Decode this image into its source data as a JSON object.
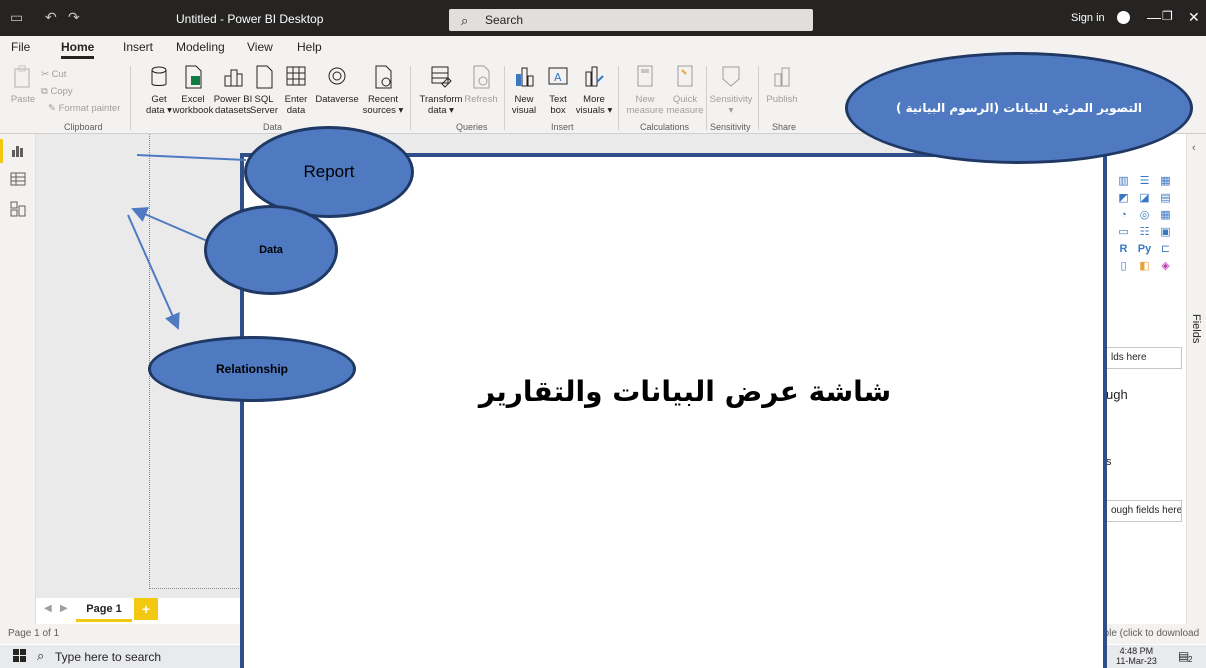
{
  "titlebar": {
    "title": "Untitled - Power BI Desktop",
    "search_placeholder": "Search",
    "sign_in": "Sign in"
  },
  "menu_tabs": [
    "File",
    "Home",
    "Insert",
    "Modeling",
    "View",
    "Help"
  ],
  "ribbon": {
    "clipboard": {
      "paste": "Paste",
      "cut": "Cut",
      "copy": "Copy",
      "format_painter": "Format painter",
      "label": "Clipboard"
    },
    "data": {
      "get_data": [
        "Get",
        "data ▾"
      ],
      "excel": [
        "Excel",
        "workbook"
      ],
      "powerbi": [
        "Power BI",
        "datasets"
      ],
      "sql": [
        "SQL",
        "Server"
      ],
      "enter": [
        "Enter",
        "data"
      ],
      "dataverse": [
        "Dataverse",
        ""
      ],
      "recent": [
        "Recent",
        "sources ▾"
      ],
      "label": "Data"
    },
    "queries": {
      "transform": [
        "Transform",
        "data ▾"
      ],
      "refresh": "Refresh",
      "label": "Queries"
    },
    "insert": {
      "new_visual": [
        "New",
        "visual"
      ],
      "text_box": [
        "Text",
        "box"
      ],
      "more_visuals": [
        "More",
        "visuals ▾"
      ],
      "label": "Insert"
    },
    "calculations": {
      "new_measure": [
        "New",
        "measure"
      ],
      "quick_measure": [
        "Quick",
        "measure"
      ],
      "label": "Calculations"
    },
    "sensitivity": {
      "button": [
        "Sensitivity",
        "▾"
      ],
      "label": "Sensitivity"
    },
    "share": {
      "publish": "Publish",
      "label": "Share"
    }
  },
  "pages": {
    "current": "Page 1",
    "add": "+"
  },
  "status": {
    "page_info": "Page 1 of 1",
    "update": "able (click to download"
  },
  "panes": {
    "fields_label": "Fields",
    "drop_field_1": "lds here",
    "drill_label": "ugh",
    "drop_field_2": "ough fields here",
    "letter_s": "s"
  },
  "taskbar": {
    "search": "Type here to search",
    "time": "4:48 PM",
    "date": "11-Mar-23",
    "notifications": "2"
  },
  "annotations": {
    "visuals_note": "التصوير المرئي للبيانات (الرسوم البيانية )",
    "report": "Report",
    "data": "Data",
    "relationship": "Relationship",
    "main_screen": "شاشة عرض البيانات والتقارير"
  },
  "colors": {
    "accent": "#f2c811",
    "ellipse_fill": "#4f7ac1",
    "frame": "#2f4f8a",
    "titlebar": "#252423"
  },
  "icons": [
    "save-icon",
    "undo-icon",
    "redo-icon",
    "search-icon",
    "report-view-icon",
    "data-view-icon",
    "model-view-icon",
    "windows-start-icon",
    "notification-icon"
  ]
}
